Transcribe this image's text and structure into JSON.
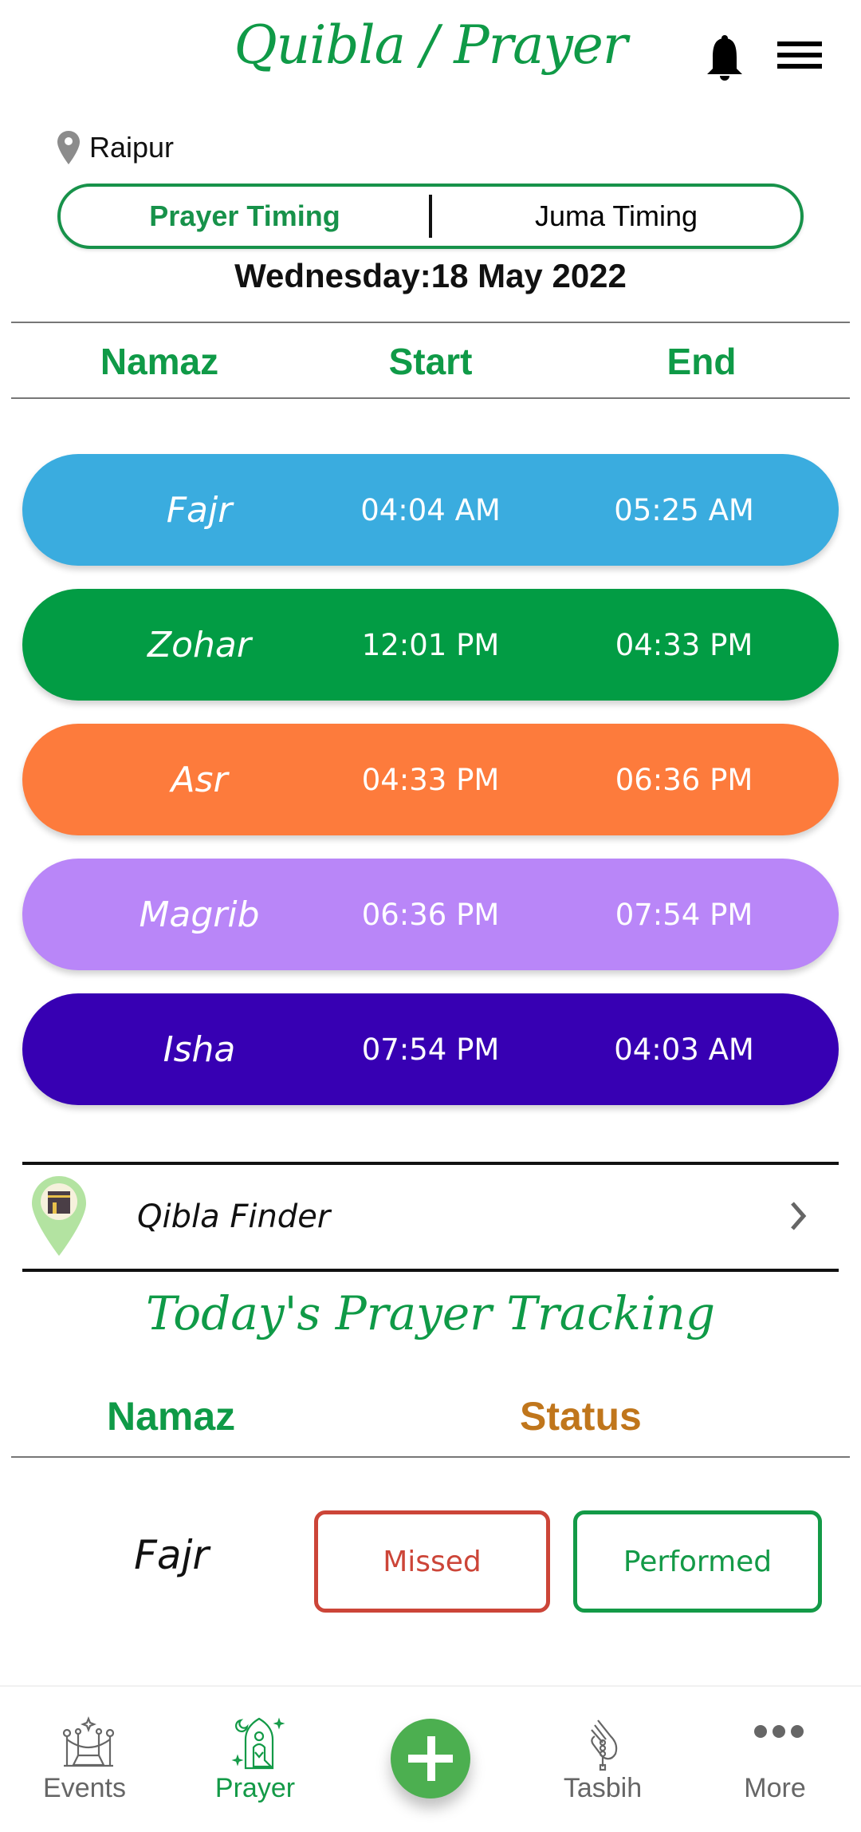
{
  "header": {
    "title": "Quibla / Prayer",
    "notification_icon": "bell-icon",
    "menu_icon": "hamburger-menu-icon"
  },
  "location": {
    "icon": "map-pin-icon",
    "city": "Raipur"
  },
  "segments": {
    "tabs": [
      {
        "label": "Prayer Timing",
        "active": true
      },
      {
        "label": "Juma Timing",
        "active": false
      }
    ]
  },
  "date": "Wednesday:18 May 2022",
  "timing_table": {
    "columns": [
      "Namaz",
      "Start",
      "End"
    ],
    "rows": [
      {
        "name": "Fajr",
        "start": "04:04 AM",
        "end": "05:25 AM",
        "color": "#3aacdf"
      },
      {
        "name": "Zohar",
        "start": "12:01 PM",
        "end": "04:33 PM",
        "color": "#029c44"
      },
      {
        "name": "Asr",
        "start": "04:33 PM",
        "end": "06:36 PM",
        "color": "#fd7b3c"
      },
      {
        "name": "Magrib",
        "start": "06:36 PM",
        "end": "07:54 PM",
        "color": "#b986f8"
      },
      {
        "name": "Isha",
        "start": "07:54 PM",
        "end": "04:03 AM",
        "color": "#3700b3"
      }
    ]
  },
  "qibla_finder": {
    "icon": "kaaba-location-pin-icon",
    "label": "Qibla Finder",
    "chevron_icon": "chevron-right-icon"
  },
  "tracking": {
    "title": "Today's Prayer Tracking",
    "columns": {
      "namaz": "Namaz",
      "status": "Status"
    },
    "status_color": "#c0761c",
    "rows": [
      {
        "name": "Fajr",
        "missed_label": "Missed",
        "performed_label": "Performed"
      }
    ]
  },
  "bottom_nav": {
    "items": [
      {
        "label": "Events",
        "icon": "events-stanchion-icon",
        "active": false
      },
      {
        "label": "Prayer",
        "icon": "praying-person-icon",
        "active": true
      },
      {
        "label": "Tasbih",
        "icon": "tasbih-hand-icon",
        "active": false
      },
      {
        "label": "More",
        "icon": "more-dots-icon",
        "active": false
      }
    ],
    "fab_icon": "plus-icon"
  },
  "colors": {
    "brand_green": "#0f9a47",
    "missed_red": "#cc4538",
    "performed_green": "#139a47"
  }
}
